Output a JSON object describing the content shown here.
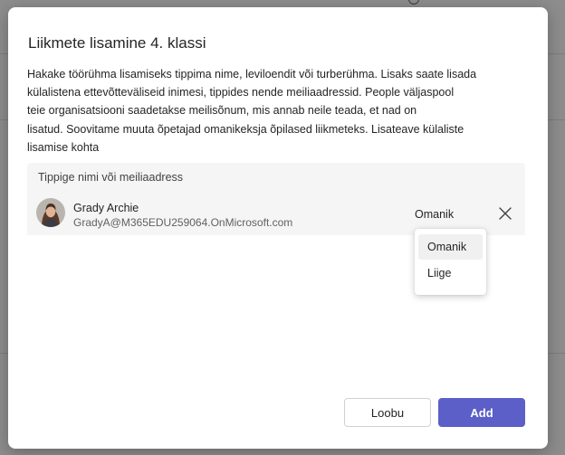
{
  "dialog": {
    "title": "Liikmete lisamine 4. klassi",
    "description": [
      "Hakake töörühma lisamiseks tippima nime, leviloendit või turberühma. Lisaks saate lisada",
      "külalistena ettevõtteväliseid inimesi, tippides nende meiliaadressid. People väljaspool",
      "teie organisatsiooni saadetakse meilisõnum, mis annab neile teada, et nad on",
      "lisatud. Soovitame muuta õpetajad omanikeksja õpilased liikmeteks. Lisateave külaliste",
      "lisamise kohta"
    ],
    "search": {
      "placeholder": "Tippige nimi või meiliaadress",
      "value": ""
    },
    "member": {
      "name": "Grady Archie",
      "email": "GradyA@M365EDU259064.OnMicrosoft.com",
      "role": "Omanik"
    },
    "role_options": [
      "Omanik",
      "Liige"
    ],
    "buttons": {
      "cancel": "Loobu",
      "add": "Add"
    }
  },
  "colors": {
    "accent": "#5b5fc7",
    "field_background": "#f5f5f5",
    "overlay": "#8d8d8d"
  },
  "icons": {
    "remove": "close-icon",
    "avatar": "avatar-photo"
  }
}
